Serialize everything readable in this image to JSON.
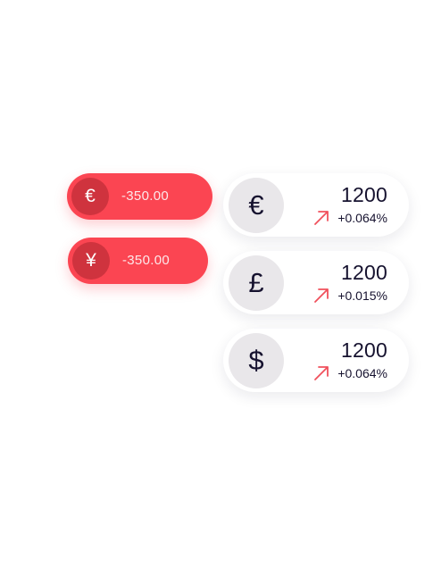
{
  "colors": {
    "loss_pill": "#fb4552",
    "loss_coin": "#cf333e",
    "card_background": "#ffffff",
    "card_coin": "#e9e7ea",
    "text_dark": "#16122f",
    "arrow": "#f0505c"
  },
  "losses": [
    {
      "symbol": "€",
      "amount": "-350.00"
    },
    {
      "symbol": "¥",
      "amount": "-350.00"
    }
  ],
  "prices": [
    {
      "symbol": "€",
      "value": "1200",
      "change": "+0.064%",
      "icon": "arrow-up-right-icon"
    },
    {
      "symbol": "£",
      "value": "1200",
      "change": "+0.015%",
      "icon": "arrow-up-right-icon"
    },
    {
      "symbol": "$",
      "value": "1200",
      "change": "+0.064%",
      "icon": "arrow-up-right-icon"
    }
  ]
}
